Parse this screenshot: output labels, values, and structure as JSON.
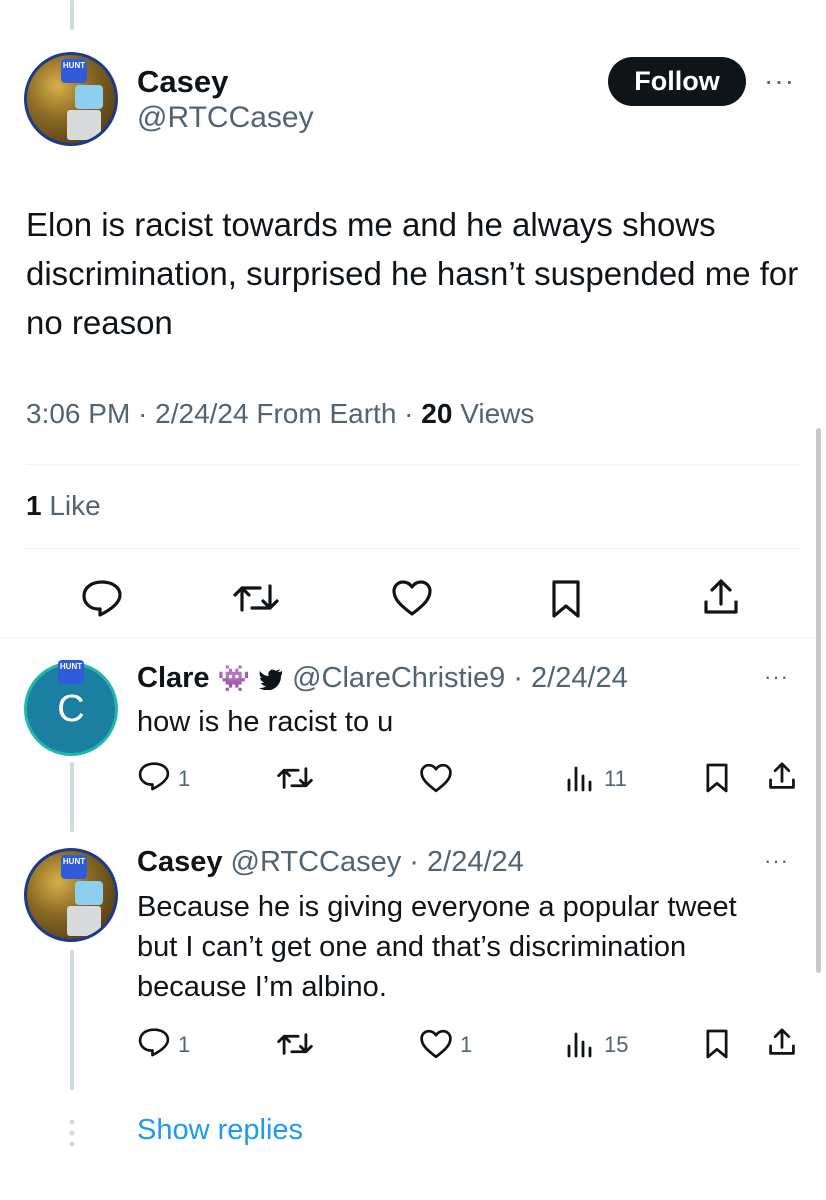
{
  "main_tweet": {
    "name": "Casey",
    "handle": "@RTCCasey",
    "follow_label": "Follow",
    "more_label": "···",
    "avatar_badge": "HUNT",
    "text": "Elon is racist towards me and he always shows discrimination, surprised he hasn’t suspended me for no reason",
    "time": "3:06 PM · 2/24/24 From Earth · ",
    "views_count": "20",
    "views_label": " Views",
    "likes_count": "1",
    "likes_label": " Like"
  },
  "replies": [
    {
      "name": "Clare",
      "emoji": "👾",
      "handle_date": "@ClareChristie9 · 2/24/24",
      "avatar_letter": "C",
      "avatar_badge": "HUNT",
      "text": "how is he racist to u",
      "reply_count": "1",
      "like_count": "",
      "views_count": "11"
    },
    {
      "name": "Casey",
      "handle_date": "@RTCCasey · 2/24/24",
      "avatar_badge": "HUNT",
      "text": "Because he is giving everyone a popular tweet but I can’t get one and that’s discrimination because I’m albino.",
      "reply_count": "1",
      "like_count": "1",
      "views_count": "15"
    }
  ],
  "show_replies_label": "Show replies",
  "colors": {
    "accent": "#1d9bf0",
    "text": "#0f1419",
    "muted": "#536471"
  }
}
